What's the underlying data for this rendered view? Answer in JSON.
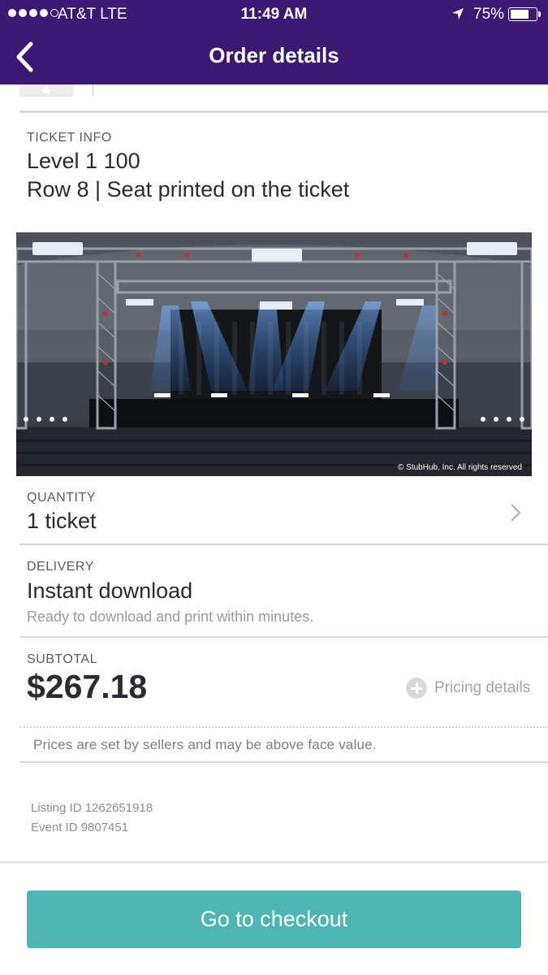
{
  "status_bar": {
    "carrier": "AT&T  LTE",
    "time": "11:49 AM",
    "battery": "75%",
    "battery_level": 0.75
  },
  "nav": {
    "title": "Order details",
    "back_icon": "chevron-left-icon"
  },
  "ticket_info": {
    "label": "TICKET INFO",
    "level": "Level 1 100",
    "row_seat": "Row 8 | Seat printed on the ticket"
  },
  "stage_image": {
    "copyright": "© StubHub, Inc. All rights reserved"
  },
  "quantity": {
    "label": "QUANTITY",
    "value": "1 ticket"
  },
  "delivery": {
    "label": "DELIVERY",
    "value": "Instant download",
    "note": "Ready to download and print within minutes."
  },
  "subtotal": {
    "label": "SUBTOTAL",
    "amount": "$267.18",
    "pricing_details": "Pricing details"
  },
  "disclaimer": "Prices are set by sellers and may be above face value.",
  "ids": {
    "listing": "Listing ID 1262651918",
    "event": "Event ID 9807451"
  },
  "checkout_button": "Go to checkout",
  "colors": {
    "nav_bg": "#3a1873",
    "button": "#4fb5b3"
  }
}
